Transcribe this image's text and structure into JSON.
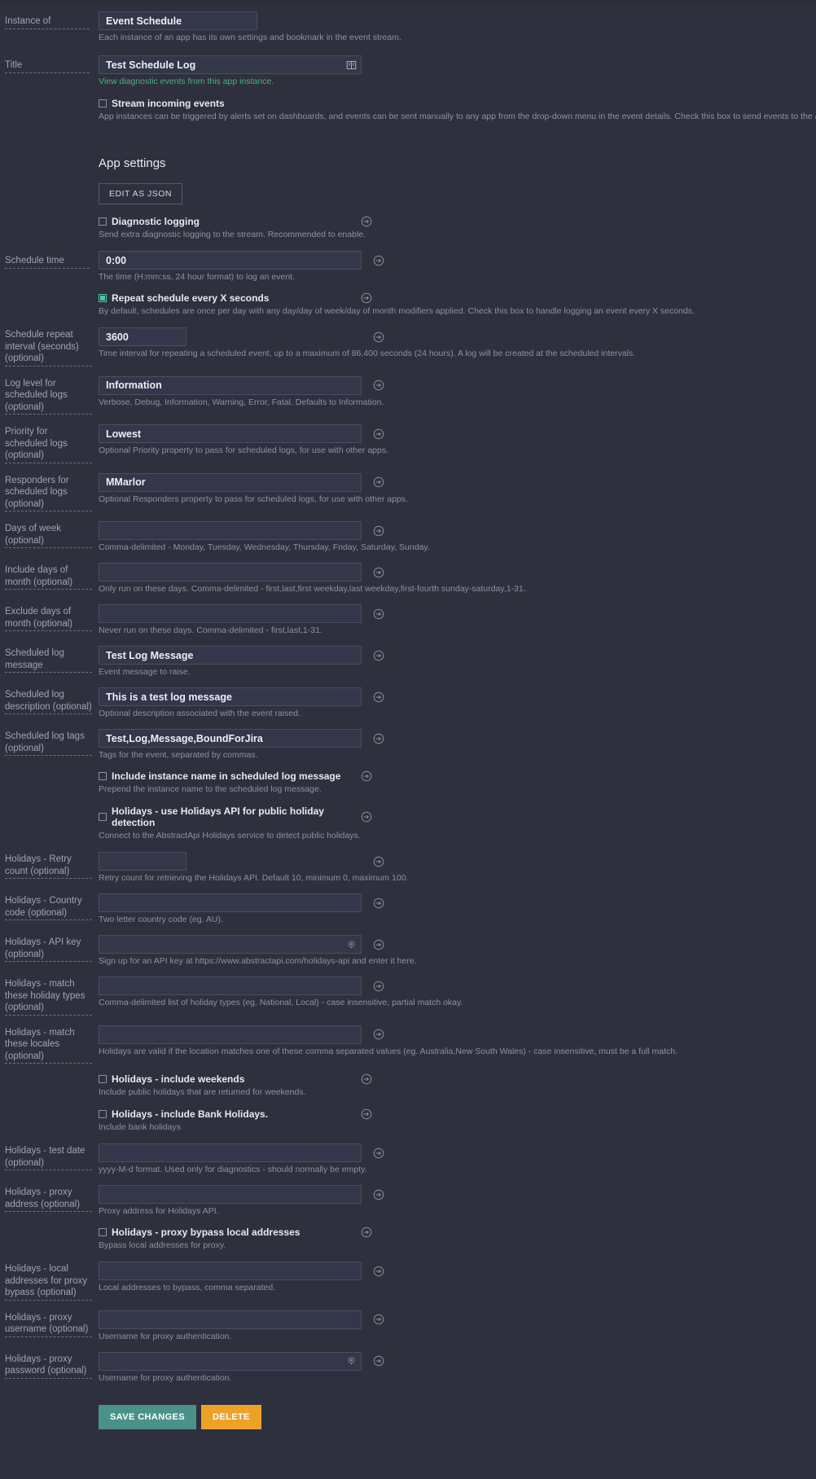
{
  "colors": {
    "background": "#2e313d",
    "input_bg": "#34374a",
    "input_border": "#4a4e63",
    "label": "#9ea3b4",
    "hint": "#8c90a3",
    "link_green": "#4caf82",
    "accent_check": "#4ec9a5",
    "save_button": "#4a9289",
    "delete_button": "#eda227"
  },
  "header": {
    "instance_of": {
      "label": "Instance of",
      "value": "Event Schedule",
      "hint": "Each instance of an app has its own settings and bookmark in the event stream."
    },
    "title": {
      "label": "Title",
      "value": "Test Schedule Log",
      "icon": "book-icon",
      "hint": "View diagnostic events from this app instance."
    },
    "stream_incoming": {
      "label": "Stream incoming events",
      "checked": false,
      "hint": "App instances can be triggered by alerts set on dashboards, and events can be sent manually to any app from the drop-down menu in the event details. Check this box to send events to the app as they are ingested."
    }
  },
  "app_settings": {
    "heading": "App settings",
    "edit_as_json_label": "EDIT AS JSON",
    "reset_icon": "reset-arrow-icon",
    "fields": [
      {
        "kind": "checkbox",
        "name": "diagnostic-logging",
        "label": "Diagnostic logging",
        "checked": false,
        "hint": "Send extra diagnostic logging to the stream. Recommended to enable."
      },
      {
        "kind": "text",
        "name": "schedule-time",
        "label": "Schedule time",
        "value": "0:00",
        "width": "wide",
        "hint": "The time (H:mm:ss, 24 hour format) to log an event."
      },
      {
        "kind": "checkbox",
        "name": "repeat-schedule-every-x-seconds",
        "label": "Repeat schedule every X seconds",
        "checked": true,
        "hint": "By default, schedules are once per day with any day/day of week/day of month modifiers applied. Check this box to handle logging an event every X seconds."
      },
      {
        "kind": "text",
        "name": "schedule-repeat-interval",
        "label": "Schedule repeat interval (seconds) (optional)",
        "value": "3600",
        "width": "narrow",
        "hint": "Time interval for repeating a scheduled event, up to a maximum of 86,400 seconds (24 hours). A log will be created at the scheduled intervals."
      },
      {
        "kind": "text",
        "name": "log-level-for-scheduled-logs",
        "label": "Log level for scheduled logs (optional)",
        "value": "Information",
        "width": "wide",
        "hint": "Verbose, Debug, Information, Warning, Error, Fatal. Defaults to Information."
      },
      {
        "kind": "text",
        "name": "priority-for-scheduled-logs",
        "label": "Priority for scheduled logs (optional)",
        "value": "Lowest",
        "width": "wide",
        "hint": "Optional Priority property to pass for scheduled logs, for use with other apps."
      },
      {
        "kind": "text",
        "name": "responders-for-scheduled-logs",
        "label": "Responders for scheduled logs (optional)",
        "value": "MMarlor",
        "width": "wide",
        "hint": "Optional Responders property to pass for scheduled logs, for use with other apps."
      },
      {
        "kind": "text",
        "name": "days-of-week",
        "label": "Days of week (optional)",
        "value": "",
        "width": "wide",
        "hint": "Comma-delimited - Monday, Tuesday, Wednesday, Thursday, Friday, Saturday, Sunday."
      },
      {
        "kind": "text",
        "name": "include-days-of-month",
        "label": "Include days of month (optional)",
        "value": "",
        "width": "wide",
        "hint": "Only run on these days. Comma-delimited - first,last,first weekday,last weekday,first-fourth sunday-saturday,1-31."
      },
      {
        "kind": "text",
        "name": "exclude-days-of-month",
        "label": "Exclude days of month (optional)",
        "value": "",
        "width": "wide",
        "hint": "Never run on these days. Comma-delimited - first,last,1-31."
      },
      {
        "kind": "text",
        "name": "scheduled-log-message",
        "label": "Scheduled log message",
        "value": "Test Log Message",
        "width": "wide",
        "hint": "Event message to raise."
      },
      {
        "kind": "text",
        "name": "scheduled-log-description",
        "label": "Scheduled log description (optional)",
        "value": "This is a test log message",
        "width": "wide",
        "hint": "Optional description associated with the event raised."
      },
      {
        "kind": "text",
        "name": "scheduled-log-tags",
        "label": "Scheduled log tags (optional)",
        "value": "Test,Log,Message,BoundForJira",
        "width": "wide",
        "hint": "Tags for the event, separated by commas."
      },
      {
        "kind": "checkbox",
        "name": "include-instance-name",
        "label": "Include instance name in scheduled log message",
        "checked": false,
        "hint": "Prepend the instance name to the scheduled log message."
      },
      {
        "kind": "checkbox",
        "name": "holidays-use-api",
        "label": "Holidays - use Holidays API for public holiday detection",
        "checked": false,
        "hint": "Connect to the AbstractApi Holidays service to detect public holidays."
      },
      {
        "kind": "text",
        "name": "holidays-retry-count",
        "label": "Holidays - Retry count (optional)",
        "value": "",
        "width": "narrow",
        "hint": "Retry count for retrieving the Holidays API. Default 10, minimum 0, maximum 100."
      },
      {
        "kind": "text",
        "name": "holidays-country-code",
        "label": "Holidays - Country code (optional)",
        "value": "",
        "width": "wide",
        "hint": "Two letter country code (eg. AU)."
      },
      {
        "kind": "password",
        "name": "holidays-api-key",
        "label": "Holidays - API key (optional)",
        "value": "",
        "width": "wide",
        "icon": "eye-reveal-icon",
        "hint": "Sign up for an API key at https://www.abstractapi.com/holidays-api and enter it here."
      },
      {
        "kind": "text",
        "name": "holidays-match-holiday-types",
        "label": "Holidays - match these holiday types (optional)",
        "value": "",
        "width": "wide",
        "hint": "Comma-delimited list of holiday types (eg. National, Local) - case insensitive, partial match okay."
      },
      {
        "kind": "text",
        "name": "holidays-match-locales",
        "label": "Holidays - match these locales (optional)",
        "value": "",
        "width": "wide",
        "hint": "Holidays are valid if the location matches one of these comma separated values (eg. Australia,New South Wales) - case insensitive, must be a full match."
      },
      {
        "kind": "checkbox",
        "name": "holidays-include-weekends",
        "label": "Holidays - include weekends",
        "checked": false,
        "hint": "Include public holidays that are returned for weekends."
      },
      {
        "kind": "checkbox",
        "name": "holidays-include-bank-holidays",
        "label": "Holidays - include Bank Holidays.",
        "checked": false,
        "hint": "Include bank holidays"
      },
      {
        "kind": "text",
        "name": "holidays-test-date",
        "label": "Holidays - test date (optional)",
        "value": "",
        "width": "wide",
        "hint": "yyyy-M-d format. Used only for diagnostics - should normally be empty."
      },
      {
        "kind": "text",
        "name": "holidays-proxy-address",
        "label": "Holidays - proxy address (optional)",
        "value": "",
        "width": "wide",
        "hint": "Proxy address for Holidays API."
      },
      {
        "kind": "checkbox",
        "name": "holidays-proxy-bypass-local",
        "label": "Holidays - proxy bypass local addresses",
        "checked": false,
        "hint": "Bypass local addresses for proxy."
      },
      {
        "kind": "text",
        "name": "holidays-local-addresses-bypass",
        "label": "Holidays - local addresses for proxy bypass (optional)",
        "value": "",
        "width": "wide",
        "hint": "Local addresses to bypass, comma separated."
      },
      {
        "kind": "text",
        "name": "holidays-proxy-username",
        "label": "Holidays - proxy username (optional)",
        "value": "",
        "width": "wide",
        "hint": "Username for proxy authentication."
      },
      {
        "kind": "password",
        "name": "holidays-proxy-password",
        "label": "Holidays - proxy password (optional)",
        "value": "",
        "width": "wide",
        "icon": "eye-reveal-icon",
        "hint": "Username for proxy authentication."
      }
    ]
  },
  "footer": {
    "save_label": "SAVE CHANGES",
    "delete_label": "DELETE"
  }
}
